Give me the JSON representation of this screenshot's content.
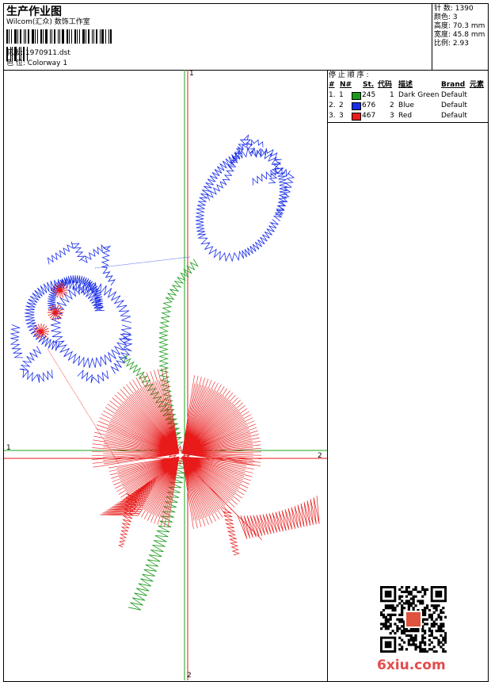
{
  "header": {
    "title": "生产作业图",
    "company": "Wilcom(汇众) 数饰工作室",
    "design_label": "花版:",
    "design_value": "1970911.dst",
    "colorway_label": "色 位:",
    "colorway_value": "Colorway 1"
  },
  "stats": {
    "stitches_label": "针 数:",
    "stitches_value": "1390",
    "colors_label": "颜色:",
    "colors_value": "3",
    "height_label": "高度:",
    "height_value": "70.3 mm",
    "width_label": "宽度:",
    "width_value": "45.8 mm",
    "scale_label": "比例:",
    "scale_value": "2.93"
  },
  "stop_sequence": {
    "title": "停 止 顺 序 :",
    "headers": [
      "#",
      "N#",
      "St.",
      "代码",
      "描述",
      "Brand",
      "元素"
    ],
    "rows": [
      {
        "num": "1.",
        "n": "1",
        "color": "#1a9a1a",
        "st": "245",
        "code": "1",
        "desc": "Dark Green",
        "brand": "Default"
      },
      {
        "num": "2.",
        "n": "2",
        "color": "#1a2ee8",
        "st": "676",
        "code": "2",
        "desc": "Blue",
        "brand": "Default"
      },
      {
        "num": "3.",
        "n": "3",
        "color": "#e81a1a",
        "st": "467",
        "code": "3",
        "desc": "Red",
        "brand": "Default"
      }
    ]
  },
  "axes": {
    "v_top": "1",
    "v_bottom": "2",
    "h_left": "1",
    "h_right": "2"
  },
  "watermark": "6xiu.com",
  "colors": {
    "green": "#1a9a1a",
    "blue": "#1a2ee8",
    "red": "#e81a1a"
  }
}
